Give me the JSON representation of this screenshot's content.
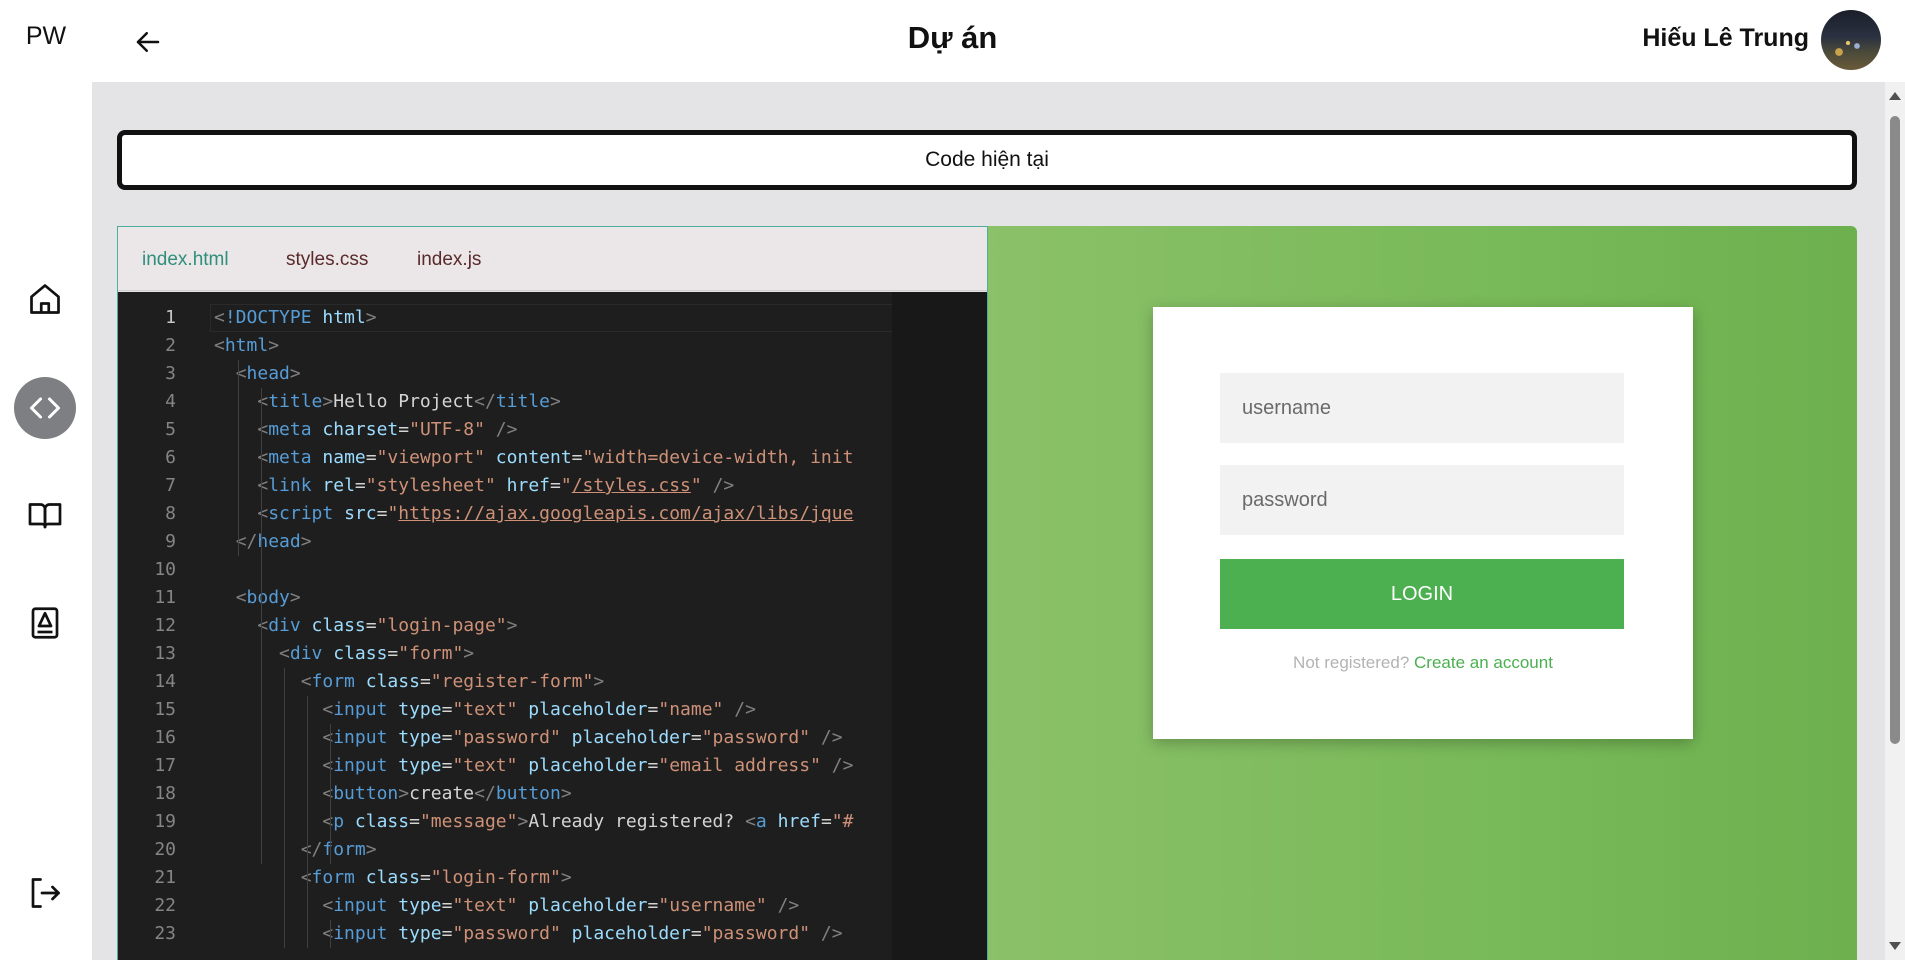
{
  "app": {
    "logo": "PW"
  },
  "header": {
    "title": "Dự án",
    "user_name": "Hiếu Lê Trung"
  },
  "sidebar": {
    "items": [
      {
        "name": "home",
        "icon": "home-icon"
      },
      {
        "name": "code",
        "icon": "code-icon",
        "active": true
      },
      {
        "name": "book",
        "icon": "book-icon"
      },
      {
        "name": "profile-book",
        "icon": "contact-book-icon"
      }
    ],
    "logout_icon": "logout-icon"
  },
  "code_button": {
    "label": "Code hiện tại"
  },
  "editor": {
    "tabs": [
      {
        "label": "index.html",
        "active": true
      },
      {
        "label": "styles.css",
        "active": false
      },
      {
        "label": "index.js",
        "active": false
      }
    ],
    "current_line": 1,
    "lines": [
      "<!DOCTYPE html>",
      "<html>",
      "  <head>",
      "    <title>Hello Project</title>",
      "    <meta charset=\"UTF-8\" />",
      "    <meta name=\"viewport\" content=\"width=device-width, init",
      "    <link rel=\"stylesheet\" href=\"/styles.css\" />",
      "    <script src=\"https://ajax.googleapis.com/ajax/libs/jque",
      "  </head>",
      "",
      "  <body>",
      "    <div class=\"login-page\">",
      "      <div class=\"form\">",
      "        <form class=\"register-form\">",
      "          <input type=\"text\" placeholder=\"name\" />",
      "          <input type=\"password\" placeholder=\"password\" />",
      "          <input type=\"text\" placeholder=\"email address\" />",
      "          <button>create</button>",
      "          <p class=\"message\">Already registered? <a href=\"#",
      "        </form>",
      "        <form class=\"login-form\">",
      "          <input type=\"text\" placeholder=\"username\" />",
      "          <input type=\"password\" placeholder=\"password\" />"
    ]
  },
  "preview": {
    "username_placeholder": "username",
    "password_placeholder": "password",
    "login_label": "LOGIN",
    "message_text": "Not registered?",
    "message_link": "Create an account"
  },
  "colors": {
    "accent_green": "#4caf50",
    "active_tab": "#2f8f7c",
    "editor_bg": "#1e1e1e"
  }
}
